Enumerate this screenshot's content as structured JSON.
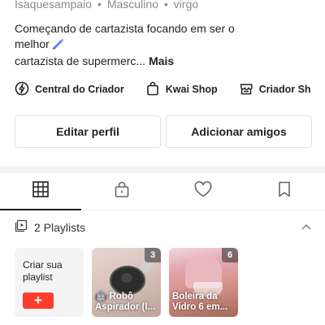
{
  "profile": {
    "username": "Isaquesampaio",
    "gender": "Masculino",
    "sign": "virgo",
    "separator": "•",
    "bio_line1": "Começando de cartazista focando em ser o",
    "bio_line2": "melhor",
    "bio_line3": "cartazista de supermerc...",
    "more_label": "Mais"
  },
  "quick_links": [
    {
      "label": "Central do Criador",
      "icon": "lightning-icon"
    },
    {
      "label": "Kwai Shop",
      "icon": "shopping-bag-icon"
    },
    {
      "label": "Criador Sh",
      "icon": "store-icon"
    }
  ],
  "actions": {
    "edit_profile": "Editar perfil",
    "add_friends": "Adicionar amigos"
  },
  "tabs": [
    {
      "name": "grid-icon",
      "selected": true
    },
    {
      "name": "lock-icon",
      "selected": false
    },
    {
      "name": "heart-icon",
      "selected": false
    },
    {
      "name": "bookmark-icon",
      "selected": false
    }
  ],
  "playlists": {
    "title": "2 Playlists",
    "create_label": "Criar sua playlist",
    "create_symbol": "+",
    "items": [
      {
        "title": "🤖 Robô Aspirador (I...",
        "count": "3"
      },
      {
        "title": "Boleira da Vidro 6 em...",
        "count": "6"
      }
    ]
  },
  "colors": {
    "accent": "#ff3d2e",
    "text": "#222222",
    "muted": "#8a8a8a",
    "separator": "#f4f4f4"
  }
}
